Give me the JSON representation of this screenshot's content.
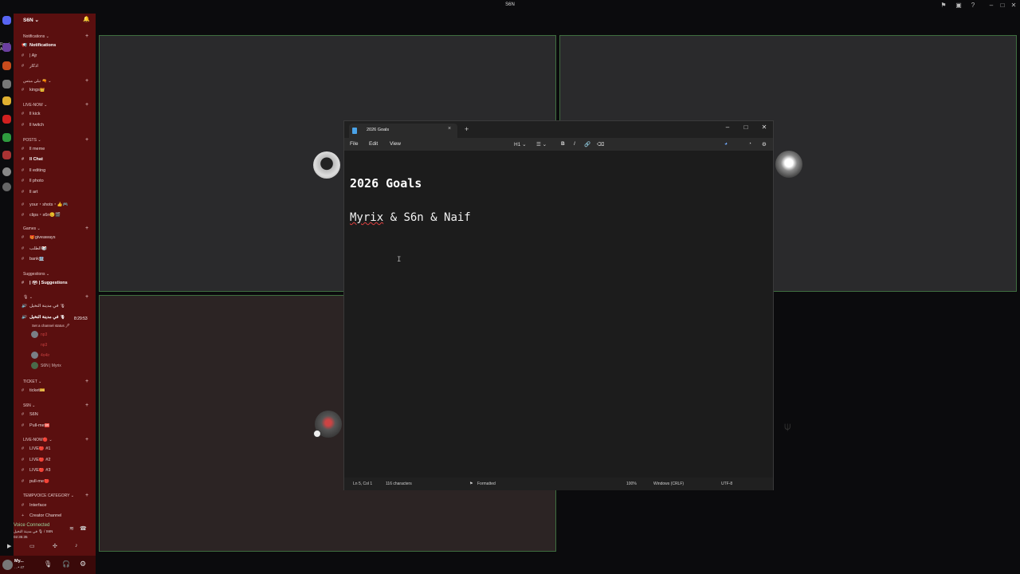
{
  "window": {
    "title": "S6N"
  },
  "server_bar": {
    "read_all": "Read All"
  },
  "sidebar": {
    "server_name": "S6N ⌄",
    "categories": {
      "notifications": "Notifications ⌄",
      "arabic1": "نبلي مبتس 🔫 ⌄",
      "live_now": "LIVE-NOW ⌄",
      "posts": "POSTS ⌄",
      "games": "Games ⌄",
      "suggestions": "Suggestions ⌄",
      "voice": "🎙 ⌄",
      "ticket": "TICKET ⌄",
      "s6n": "S6N ⌄",
      "live_now2": "LIVE-NOW🔴 ⌄",
      "tempvoice": "TEMPVOICE CATEGORY ⌄"
    },
    "channels": {
      "notifications": "Notifications",
      "ajr": "| Ajr",
      "athkar": "أذكار",
      "kings": "kings👑",
      "kick": "ll kick",
      "twitch": "ll twitch",
      "meme": "ll meme",
      "chat": "ll Chat",
      "editing": "ll editing",
      "photo": "ll photo",
      "art": "ll art",
      "your_shots": "your・shots・👍🎮",
      "clips": "clips・s6n😊🎬",
      "giveaways": "🎁giveaways",
      "altalab": "الطلب🎲",
      "bank": "bank🏦",
      "suggestions": "| 🗳 | Suggestions",
      "voice1": "في مدينة النخيل 🎙",
      "voice2": "في مدينة النخيل 🎙",
      "ticket": "ticket🎫",
      "s6n": "S6N",
      "pullme": "Pull-me🆘",
      "live1": "LIVE🔴 #1",
      "live2": "LIVE🔴 #2",
      "live3": "LIVE🔴 #3",
      "pullme2": "pull-me🔴",
      "interface": "Interface",
      "creator": "Creator Channel"
    },
    "voice_timer": "8:29:53",
    "channel_status": "Set a channel status 🖊",
    "voice_users": [
      "np3",
      "np3",
      "4o4ir",
      "S6N | Myrix"
    ],
    "voice_connected": {
      "title": "Voice Connected",
      "channel": "في مدينة النخيل 🎙 / S6N",
      "time": "02:35:35"
    },
    "user": {
      "name": "My...",
      "status": "…• 47"
    }
  },
  "notepad": {
    "tab_title": "2026 Goals",
    "menu": [
      "File",
      "Edit",
      "View"
    ],
    "toolbar": {
      "heading": "H1 ⌄",
      "list": "☰ ⌄",
      "bold": "B",
      "italic": "I",
      "link": "🔗",
      "clear": "⌫"
    },
    "content": {
      "heading": "2026 Goals",
      "name1": "Myrix",
      "rest": " & S6n & Naif"
    },
    "status": {
      "position": "Ln 5, Col 1",
      "chars": "116 characters",
      "format": "Formatted",
      "zoom": "100%",
      "line_ending": "Windows (CRLF)",
      "encoding": "UTF-8"
    }
  },
  "colors": {
    "channel_bg": "#5a0f0f",
    "tile_border": "#3f6e3f",
    "notepad_bg": "#1c1c1c"
  }
}
